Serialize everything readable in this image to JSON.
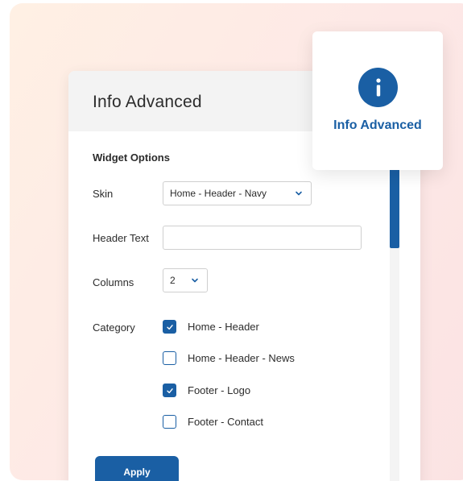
{
  "panel": {
    "title": "Info Advanced",
    "section_title": "Widget Options",
    "skin": {
      "label": "Skin",
      "value": "Home - Header - Navy"
    },
    "header_text": {
      "label": "Header Text",
      "value": ""
    },
    "columns": {
      "label": "Columns",
      "value": "2"
    },
    "category": {
      "label": "Category",
      "options": [
        {
          "label": "Home - Header",
          "checked": true
        },
        {
          "label": "Home - Header - News",
          "checked": false
        },
        {
          "label": "Footer - Logo",
          "checked": true
        },
        {
          "label": "Footer - Contact",
          "checked": false
        }
      ]
    },
    "apply_label": "Apply"
  },
  "popover": {
    "label": "Info Advanced",
    "icon": "info-icon"
  },
  "colors": {
    "accent": "#1a5fa4",
    "header_bg": "#f3f3f3"
  }
}
